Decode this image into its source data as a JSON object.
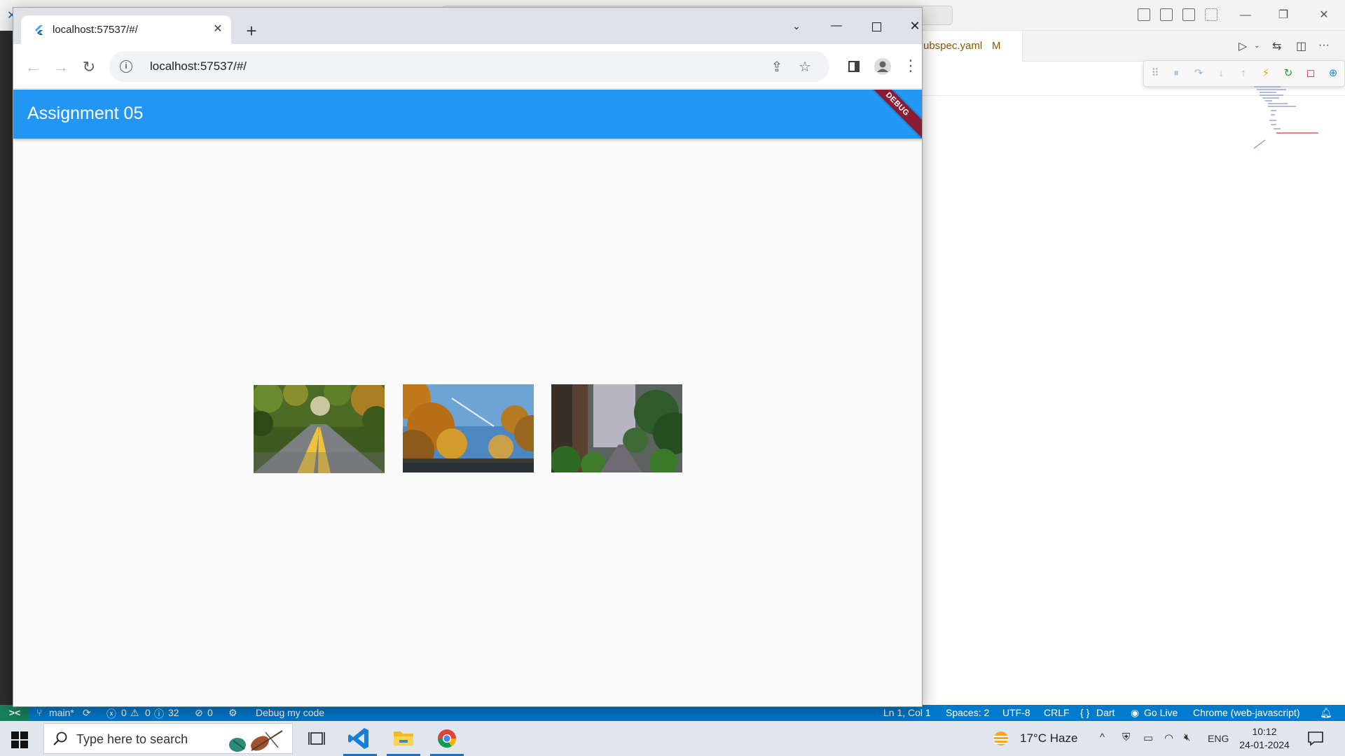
{
  "browser": {
    "tab_title": "localhost:57537/#/",
    "url": "localhost:57537/#/"
  },
  "app": {
    "title": "Assignment 05",
    "debug_banner": "DEBUG",
    "images": [
      {
        "name": "road-yellow-lines"
      },
      {
        "name": "autumn-forest-sky"
      },
      {
        "name": "misty-redwood-road"
      }
    ]
  },
  "vscode": {
    "editor_tab": {
      "label": "ubspec.yaml",
      "status": "M"
    },
    "statusbar": {
      "branch": "main*",
      "problems": "0",
      "warnings": "0",
      "infos": "32",
      "ports": "0",
      "debug_label": "Debug my code",
      "cursor": "Ln 1, Col 1",
      "spaces": "Spaces: 2",
      "encoding": "UTF-8",
      "eol": "CRLF",
      "language": "Dart",
      "go_live": "Go Live",
      "device": "Chrome (web-javascript)"
    }
  },
  "taskbar": {
    "search_placeholder": "Type here to search",
    "weather": "17°C  Haze",
    "language": "ENG",
    "time": "10:12",
    "date": "24-01-2024"
  },
  "colors": {
    "appbar": "#2196f3",
    "statusbar": "#007acc",
    "debug_banner": "#8a1b34"
  }
}
